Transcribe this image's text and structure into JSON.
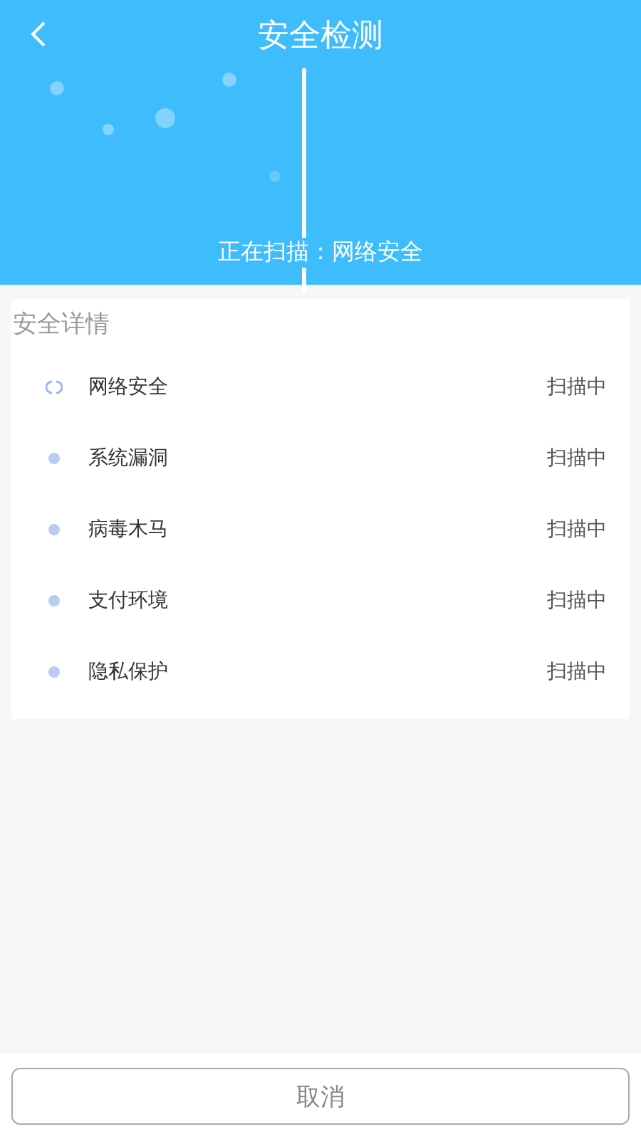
{
  "header": {
    "title": "安全检测",
    "scan_status": "正在扫描：网络安全"
  },
  "details": {
    "title": "安全详情",
    "items": [
      {
        "name": "网络安全",
        "status": "扫描中",
        "active": true
      },
      {
        "name": "系统漏洞",
        "status": "扫描中",
        "active": false
      },
      {
        "name": "病毒木马",
        "status": "扫描中",
        "active": false
      },
      {
        "name": "支付环境",
        "status": "扫描中",
        "active": false
      },
      {
        "name": "隐私保护",
        "status": "扫描中",
        "active": false
      }
    ]
  },
  "buttons": [
    "取消"
  ]
}
